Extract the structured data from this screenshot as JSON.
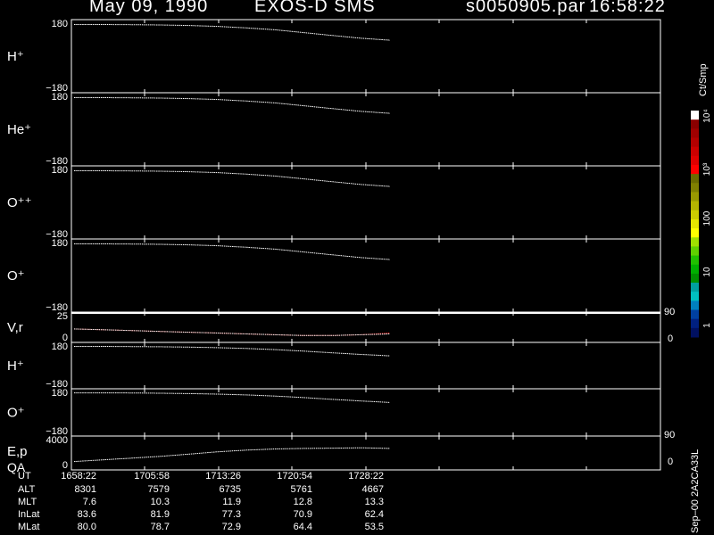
{
  "header": {
    "date": "May 09, 1990",
    "instrument": "EXOS-D SMS",
    "file": "s0050905.par",
    "time": "16:58:22"
  },
  "colorbar": {
    "unit": "Ct/Smp",
    "ticks": [
      "10⁴",
      "10³",
      "100",
      "10",
      "1"
    ],
    "colors": [
      "#ffffff",
      "#8b0000",
      "#a00000",
      "#b40000",
      "#cc0000",
      "#e00000",
      "#ff0000",
      "#6b6b00",
      "#808000",
      "#999900",
      "#b3b300",
      "#cccc00",
      "#e6e600",
      "#ffff00",
      "#a0e000",
      "#60d000",
      "#20c000",
      "#00b000",
      "#009000",
      "#00a0a0",
      "#00c0c0",
      "#0080c0",
      "#0040a0",
      "#002080",
      "#001060"
    ]
  },
  "right_axis_labels": {
    "v_top": "90",
    "v_bottom": "0",
    "e_top": "90",
    "e_bottom": "0"
  },
  "side_note": "Sep–00  2A2CA33L",
  "footer": {
    "labels": [
      "UT",
      "ALT",
      "MLT",
      "InLat",
      "MLat"
    ],
    "columns": [
      [
        "1658:22",
        "8301",
        "7.6",
        "83.6",
        "80.0"
      ],
      [
        "1705:58",
        "7579",
        "10.3",
        "81.9",
        "78.7"
      ],
      [
        "1713:26",
        "6735",
        "11.9",
        "77.3",
        "72.9"
      ],
      [
        "1720:54",
        "5761",
        "12.8",
        "70.9",
        "64.4"
      ],
      [
        "1728:22",
        "4667",
        "13.3",
        "62.4",
        "53.5"
      ]
    ]
  },
  "chart_data": [
    {
      "type": "line",
      "label": "H⁺",
      "ytop": "180",
      "ybottom": "−180",
      "ylim": [
        -180,
        180
      ],
      "series": [
        {
          "values": [
            168,
            168,
            167,
            166,
            163,
            158,
            150,
            140,
            125,
            110,
            95,
            85
          ]
        }
      ]
    },
    {
      "type": "line",
      "label": "He⁺",
      "ytop": "180",
      "ybottom": "−180",
      "ylim": [
        -180,
        180
      ],
      "series": [
        {
          "values": [
            168,
            168,
            167,
            166,
            163,
            158,
            150,
            140,
            125,
            110,
            95,
            85
          ]
        }
      ]
    },
    {
      "type": "line",
      "label": "O⁺⁺",
      "ytop": "180",
      "ybottom": "−180",
      "ylim": [
        -180,
        180
      ],
      "series": [
        {
          "values": [
            168,
            168,
            167,
            166,
            163,
            158,
            150,
            140,
            125,
            110,
            95,
            85
          ]
        }
      ]
    },
    {
      "type": "line",
      "label": "O⁺",
      "ytop": "180",
      "ybottom": "−180",
      "ylim": [
        -180,
        180
      ],
      "series": [
        {
          "values": [
            168,
            168,
            167,
            166,
            163,
            158,
            150,
            140,
            125,
            110,
            95,
            85
          ]
        }
      ]
    },
    {
      "type": "line",
      "label": "V,r",
      "ytop": "25",
      "ybottom": "0",
      "ylim": [
        -5,
        25
      ],
      "series": [
        {
          "values": [
            8,
            7,
            6,
            5,
            4,
            3,
            2,
            1,
            0,
            0,
            1,
            3
          ],
          "color": "#ff2020"
        },
        {
          "values": [
            8,
            7,
            6,
            5,
            4,
            3,
            2,
            1,
            0,
            0,
            1,
            2
          ],
          "color": "#ffffff"
        }
      ]
    },
    {
      "type": "line",
      "label": "H⁺",
      "ytop": "180",
      "ybottom": "−180",
      "ylim": [
        -180,
        180
      ],
      "series": [
        {
          "values": [
            168,
            168,
            167,
            165,
            162,
            157,
            150,
            140,
            127,
            112,
            98,
            85
          ]
        }
      ]
    },
    {
      "type": "line",
      "label": "O⁺",
      "ytop": "180",
      "ybottom": "−180",
      "ylim": [
        -180,
        180
      ],
      "series": [
        {
          "values": [
            168,
            168,
            167,
            165,
            162,
            157,
            150,
            140,
            127,
            112,
            98,
            85
          ]
        }
      ]
    },
    {
      "type": "line",
      "label": "E,p",
      "label2": "QA",
      "ytop": "4000",
      "ybottom": "0",
      "ylim": [
        -500,
        4500
      ],
      "series": [
        {
          "values": [
            500,
            800,
            1100,
            1400,
            1800,
            2200,
            2500,
            2700,
            2800,
            2850,
            2900,
            2800
          ]
        }
      ]
    }
  ]
}
